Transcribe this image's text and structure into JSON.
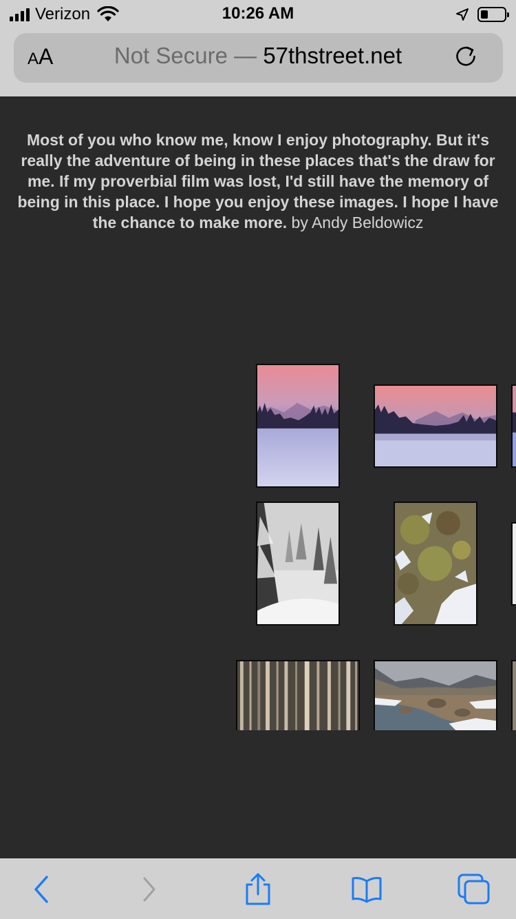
{
  "status_bar": {
    "carrier": "Verizon",
    "time": "10:26 AM",
    "icons": [
      "cellular-signal-icon",
      "wifi-icon",
      "location-arrow-icon",
      "battery-icon"
    ],
    "battery_level": 0.2
  },
  "url_bar": {
    "text_size_label_small": "A",
    "text_size_label_large": "A",
    "security_label": "Not Secure",
    "separator": "—",
    "domain": "57thstreet.net",
    "reload_icon": "reload-icon"
  },
  "page": {
    "intro_quote": "Most of you who know me, know I enjoy photography. But it's really the adventure of being in these places that's the draw for me. If my proverbial film was lost, I'd still have the memory of being in this place. I hope you enjoy these images. I hope I have the chance to make more.",
    "intro_byline": "by Andy Beldowicz",
    "background_color": "#2a2a2a",
    "text_color": "#d4d4d4"
  },
  "gallery": [
    {
      "subject": "pink sunset over snowy meadow",
      "orientation": "portrait"
    },
    {
      "subject": "pink sunset over snowy meadow",
      "orientation": "landscape"
    },
    {
      "subject": "pink sunset over snowy meadow",
      "orientation": "landscape"
    },
    {
      "subject": "snowy pine forest",
      "orientation": "portrait"
    },
    {
      "subject": "lichen covered rock with snow",
      "orientation": "portrait"
    },
    {
      "subject": "snowy scene",
      "orientation": "portrait"
    },
    {
      "subject": "aspen tree trunks",
      "orientation": "landscape"
    },
    {
      "subject": "mountain river valley with snow",
      "orientation": "landscape"
    },
    {
      "subject": "landscape",
      "orientation": "landscape"
    }
  ],
  "toolbar": {
    "back_icon": "back-chevron-icon",
    "forward_icon": "forward-chevron-icon",
    "share_icon": "share-icon",
    "bookmarks_icon": "bookmarks-icon",
    "tabs_icon": "tabs-icon",
    "accent_color": "#1a7cf5",
    "disabled_color": "#a0a0a0"
  }
}
